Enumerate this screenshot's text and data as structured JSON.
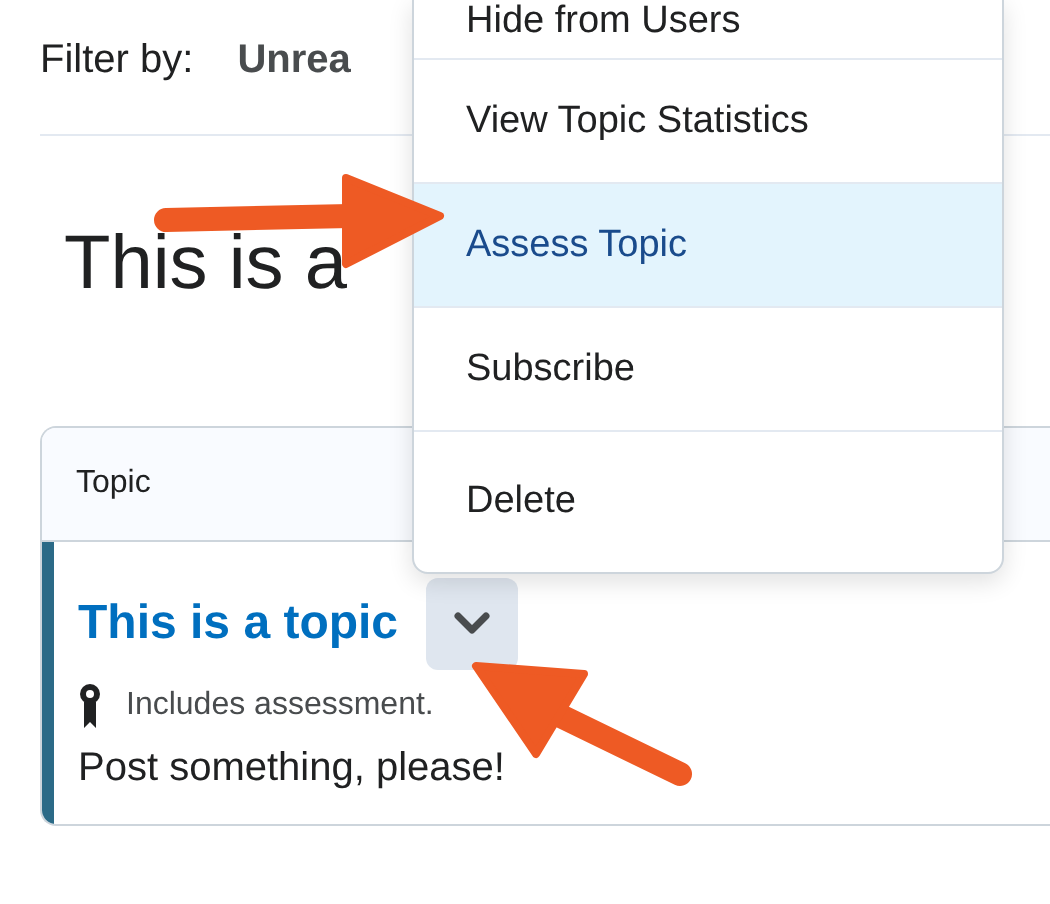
{
  "filter": {
    "label": "Filter by:",
    "value": "Unrea"
  },
  "heading": "This is a",
  "table": {
    "columns": [
      "Topic"
    ],
    "rows": [
      {
        "title": "This is a topic",
        "note": "Includes assessment.",
        "description": "Post something, please!"
      }
    ]
  },
  "menu": {
    "items": [
      {
        "label": "Hide from Users",
        "selected": false
      },
      {
        "label": "View Topic Statistics",
        "selected": false
      },
      {
        "label": "Assess Topic",
        "selected": true
      },
      {
        "label": "Subscribe",
        "selected": false
      },
      {
        "label": "Delete",
        "selected": false
      }
    ]
  }
}
